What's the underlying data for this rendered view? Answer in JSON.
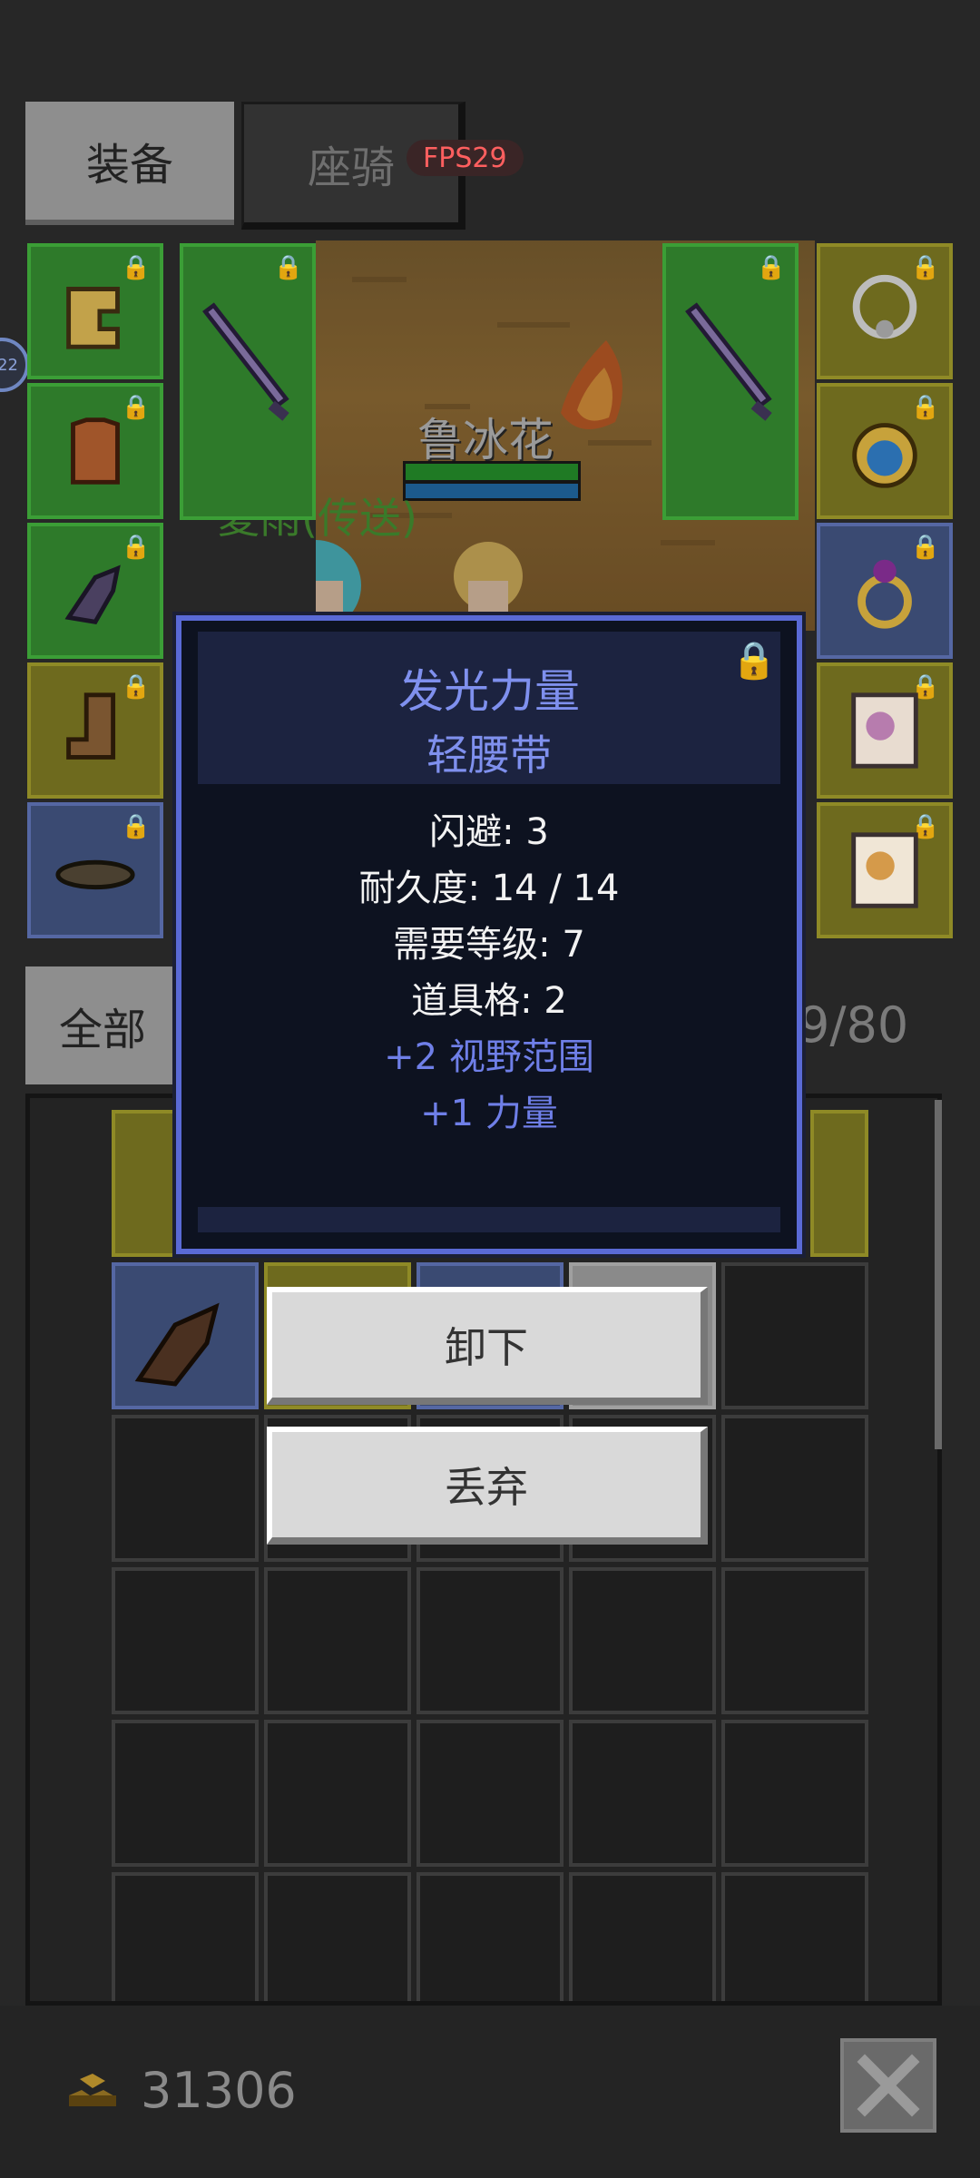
{
  "tabs": {
    "equip": "装备",
    "mount": "座骑"
  },
  "fps": "FPS29",
  "side_badge": "22",
  "scene": {
    "npc_name": "鲁冰花",
    "teleport_label": "夏雨(传送)"
  },
  "filter": {
    "all": "全部",
    "capacity": "9/80"
  },
  "tooltip": {
    "title": "发光力量",
    "subtitle": "轻腰带",
    "stats": [
      "闪避: 3",
      "耐久度: 14 / 14",
      "需要等级: 7",
      "道具格: 2"
    ],
    "bonuses": [
      "+2 视野范围",
      "+1 力量"
    ]
  },
  "actions": {
    "unequip": "卸下",
    "discard": "丢弃"
  },
  "gold": "31306",
  "colors": {
    "tooltip_accent": "#7f90ee",
    "fps_text": "#ff5f5f"
  },
  "icons": {
    "lock": "lock-icon",
    "helmet": "helmet-icon",
    "armor": "armor-icon",
    "gloves": "gloves-icon",
    "boots": "boots-icon",
    "belt": "belt-icon",
    "sword": "sword-icon",
    "necklace": "necklace-icon",
    "ring": "ring-icon",
    "card": "card-icon",
    "gold": "gold-icon",
    "close": "close-icon"
  }
}
